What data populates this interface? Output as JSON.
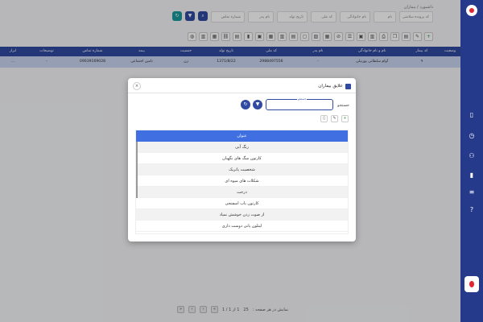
{
  "breadcrumb": "داشبورد / بیماران",
  "subtitle": "کد بیمار",
  "filters": {
    "patient_id_placeholder": "کد پرونده سلامتی",
    "first_name": "نام",
    "last_name": "نام خانوادگی",
    "national_code": "کد ملی",
    "birth_date": "تاریخ تولد",
    "father_name": "نام پدر",
    "insurance_no": "شماره تماس"
  },
  "table": {
    "headers": [
      "وضعیت",
      "کد بیمار",
      "نام و نام خانوادگی",
      "نام پدر",
      "کد ملی",
      "تاریخ تولد",
      "جنسیت",
      "بیمه",
      "شماره تماس",
      "توضیحات",
      "ابزار"
    ],
    "row": [
      "",
      "۹",
      "آوام سلطانی پورنیلی",
      "-",
      "2988497556",
      "1371/8/22",
      "زن",
      "تامین اجتماعی",
      "09039169028",
      "-",
      "..."
    ]
  },
  "pager": {
    "range": "1 از 1 / 1",
    "per_page_label": "نمایش در هر صفحه :",
    "per_page_value": "25"
  },
  "modal": {
    "title": "علایق بیماران",
    "search_label": "جستجو",
    "input_float_label": "جستجو",
    "list_header": "عنوان",
    "items": [
      "رنگ آبی",
      "کارتون سگ های نگهبان",
      "شخصیت پاتریک",
      "شکلات های میوه ای",
      "درخت",
      "کارتون باب اسفنجی",
      "از صوت زدن خوشش نمیاد",
      "لیتلون پانی دوست داری"
    ]
  },
  "colors": {
    "sidebar": "#263a8c",
    "primary": "#2f4aa0",
    "list_header": "#3f6fe0",
    "selected_row": "#c9d3ef"
  }
}
